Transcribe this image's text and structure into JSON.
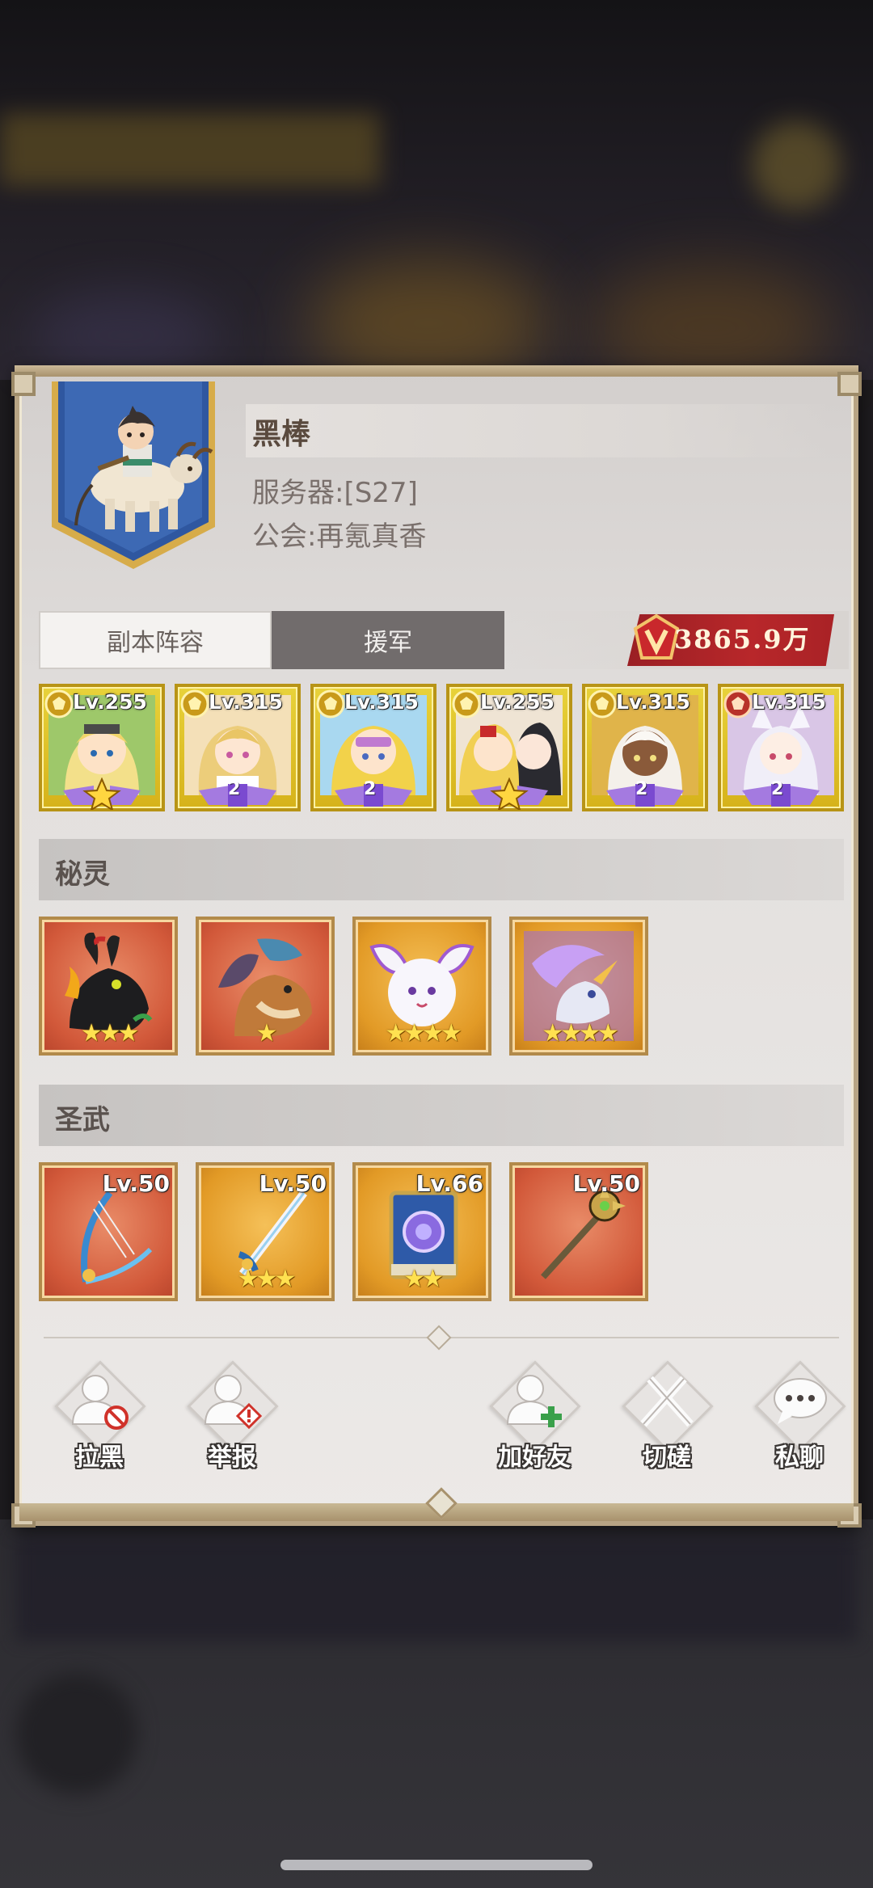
{
  "player": {
    "name": "黑棒",
    "server": "服务器:[S27]",
    "guild": "公会:再氪真香"
  },
  "tabs": [
    {
      "label": "副本阵容",
      "active": true
    },
    {
      "label": "援军",
      "active": false
    }
  ],
  "power": "3865.9万",
  "heroes": [
    {
      "level": "Lv.255",
      "grade": "star",
      "medal": "gold"
    },
    {
      "level": "Lv.315",
      "grade": "2",
      "medal": "gold"
    },
    {
      "level": "Lv.315",
      "grade": "2",
      "medal": "gold"
    },
    {
      "level": "Lv.255",
      "grade": "star",
      "medal": "gold"
    },
    {
      "level": "Lv.315",
      "grade": "2",
      "medal": "gold"
    },
    {
      "level": "Lv.315",
      "grade": "2",
      "medal": "red"
    }
  ],
  "sections": {
    "spirits": "秘灵",
    "weapons": "圣武"
  },
  "spirits": [
    {
      "stars": "★★★",
      "tile_color": "red",
      "icon": "black-dragon-rabbit-icon"
    },
    {
      "stars": "★",
      "tile_color": "red",
      "icon": "twin-dragon-icon"
    },
    {
      "stars": "★★★★",
      "tile_color": "gold",
      "icon": "white-rabbit-icon"
    },
    {
      "stars": "★★★★",
      "tile_color": "gold",
      "icon": "unicorn-icon"
    }
  ],
  "weapons": [
    {
      "level": "Lv.50",
      "stars": "",
      "tile_color": "red",
      "icon": "harp-bow-icon"
    },
    {
      "level": "Lv.50",
      "stars": "★★★",
      "tile_color": "gold",
      "icon": "sword-icon"
    },
    {
      "level": "Lv.66",
      "stars": "★★",
      "tile_color": "gold",
      "icon": "spellbook-icon"
    },
    {
      "level": "Lv.50",
      "stars": "",
      "tile_color": "red",
      "icon": "mace-icon"
    }
  ],
  "actions": {
    "block": "拉黑",
    "report": "举报",
    "add_friend": "加好友",
    "duel": "切磋",
    "chat": "私聊"
  },
  "colors": {
    "tab_active_bg": "#f4f2f0",
    "tab_inactive_bg": "#716c6c",
    "power_badge": "#b8272a",
    "hero_card_gold": "#e8d23a",
    "tile_red": "#d2593a",
    "tile_gold": "#e29a26"
  }
}
